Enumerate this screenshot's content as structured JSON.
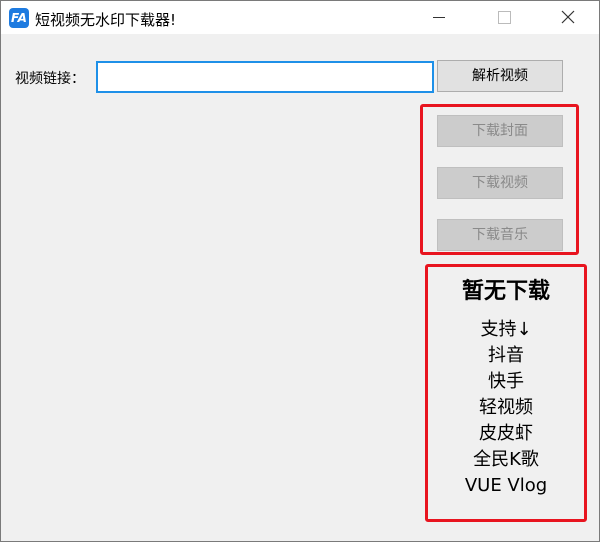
{
  "window": {
    "title": "短视频无水印下载器!",
    "icon_text": "FA",
    "controls": [
      "minimize-icon",
      "maximize-icon",
      "close-icon"
    ]
  },
  "form": {
    "url_label": "视频链接：",
    "url_value": "",
    "parse_button": "解析视频"
  },
  "downloads": {
    "cover_button": "下载封面",
    "video_button": "下载视频",
    "music_button": "下载音乐"
  },
  "status": {
    "title": "暂无下载",
    "items": [
      "支持↓",
      "抖音",
      "快手",
      "轻视频",
      "皮皮虾",
      "全民K歌",
      "VUE Vlog"
    ]
  },
  "colors": {
    "highlight": "#e8141f",
    "input_border": "#1e90e8",
    "app_icon": "#1e7be0"
  }
}
